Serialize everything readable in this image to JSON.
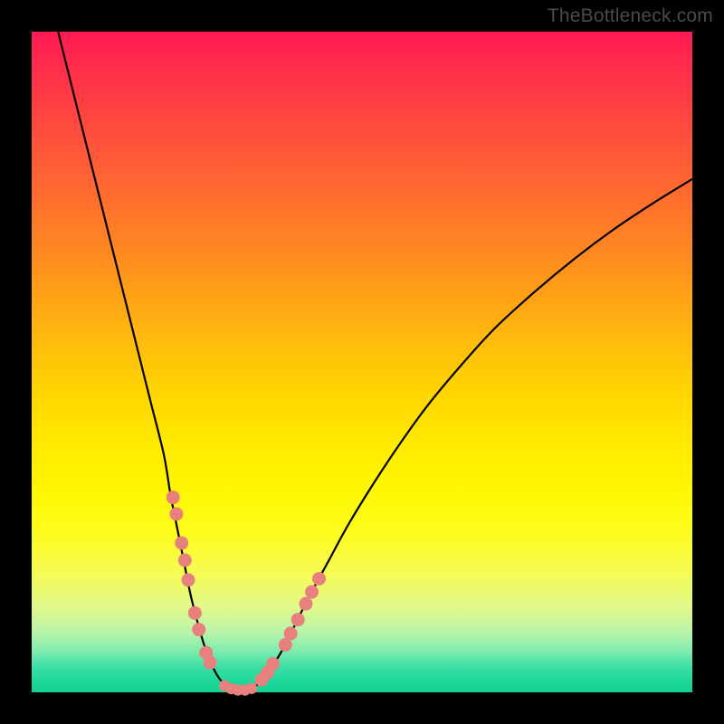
{
  "watermark": "TheBottleneck.com",
  "chart_data": {
    "type": "line",
    "title": "",
    "xlabel": "",
    "ylabel": "",
    "xlim": [
      0,
      100
    ],
    "ylim": [
      0,
      100
    ],
    "curve": {
      "name": "bottleneck-curve",
      "points": [
        [
          4,
          100
        ],
        [
          6,
          92
        ],
        [
          8,
          84
        ],
        [
          10,
          76
        ],
        [
          12,
          68
        ],
        [
          14,
          60
        ],
        [
          16,
          52
        ],
        [
          18,
          44
        ],
        [
          20,
          36
        ],
        [
          21,
          30
        ],
        [
          22,
          25
        ],
        [
          23,
          20
        ],
        [
          24,
          15
        ],
        [
          25,
          11
        ],
        [
          26,
          7.5
        ],
        [
          27,
          4.8
        ],
        [
          28,
          2.7
        ],
        [
          29,
          1.4
        ],
        [
          30,
          0.7
        ],
        [
          31,
          0.4
        ],
        [
          32,
          0.3
        ],
        [
          33,
          0.5
        ],
        [
          34,
          1.0
        ],
        [
          35,
          2.0
        ],
        [
          36,
          3.3
        ],
        [
          38,
          6.5
        ],
        [
          40,
          10.5
        ],
        [
          42,
          14.5
        ],
        [
          45,
          20
        ],
        [
          48,
          25.5
        ],
        [
          52,
          32
        ],
        [
          56,
          38
        ],
        [
          60,
          43.5
        ],
        [
          65,
          49.5
        ],
        [
          70,
          55
        ],
        [
          76,
          60.5
        ],
        [
          82,
          65.5
        ],
        [
          88,
          70
        ],
        [
          94,
          74
        ],
        [
          100,
          77.7
        ]
      ]
    },
    "markers_left": [
      [
        21.4,
        29.5
      ],
      [
        21.9,
        27.0
      ],
      [
        22.7,
        22.6
      ],
      [
        23.2,
        20.0
      ],
      [
        23.7,
        17.0
      ],
      [
        24.7,
        12.0
      ],
      [
        25.3,
        9.5
      ],
      [
        26.4,
        6.0
      ],
      [
        27.0,
        4.5
      ]
    ],
    "markers_right": [
      [
        34.8,
        1.9
      ],
      [
        35.7,
        3.0
      ],
      [
        36.5,
        4.3
      ],
      [
        38.4,
        7.2
      ],
      [
        39.2,
        8.9
      ],
      [
        40.3,
        11.0
      ],
      [
        41.5,
        13.4
      ],
      [
        42.4,
        15.2
      ],
      [
        43.5,
        17.2
      ]
    ],
    "markers_bottom": [
      [
        29.2,
        1.0
      ],
      [
        30.2,
        0.55
      ],
      [
        31.2,
        0.35
      ],
      [
        32.3,
        0.35
      ],
      [
        33.3,
        0.6
      ]
    ]
  }
}
